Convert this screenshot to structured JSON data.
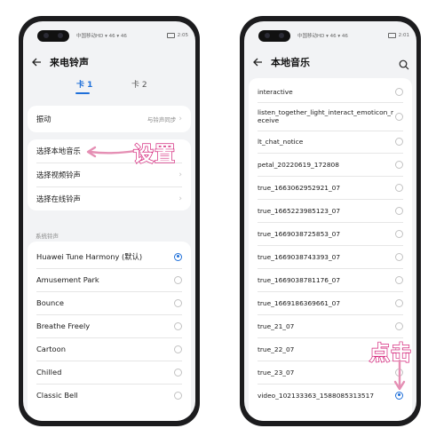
{
  "left": {
    "status": {
      "carrier": "中国移动HD ▾ 46 ▾ 46",
      "time": "2:05"
    },
    "title": "来电铃声",
    "tabs": [
      "卡 1",
      "卡 2"
    ],
    "settings": [
      {
        "label": "振动",
        "hint": "与铃声同步"
      },
      {
        "label": "选择本地音乐"
      },
      {
        "label": "选择视频铃声"
      },
      {
        "label": "选择在线铃声"
      }
    ],
    "section_label": "系统铃声",
    "ringtones": [
      {
        "label": "Huawei Tune Harmony (默认)",
        "selected": true
      },
      {
        "label": "Amusement Park",
        "selected": false
      },
      {
        "label": "Bounce",
        "selected": false
      },
      {
        "label": "Breathe Freely",
        "selected": false
      },
      {
        "label": "Cartoon",
        "selected": false
      },
      {
        "label": "Chilled",
        "selected": false
      },
      {
        "label": "Classic Bell",
        "selected": false
      }
    ],
    "annotation": "设置"
  },
  "right": {
    "status": {
      "carrier": "中国移动HD ▾ 46 ▾ 46",
      "time": "2:01"
    },
    "title": "本地音乐",
    "items": [
      {
        "label": "interactive",
        "selected": false
      },
      {
        "label": "listen_together_light_interact_emoticon_receive",
        "selected": false
      },
      {
        "label": "lt_chat_notice",
        "selected": false
      },
      {
        "label": "petal_20220619_172808",
        "selected": false
      },
      {
        "label": "true_1663062952921_07",
        "selected": false
      },
      {
        "label": "true_1665223985123_07",
        "selected": false
      },
      {
        "label": "true_1669038725853_07",
        "selected": false
      },
      {
        "label": "true_1669038743393_07",
        "selected": false
      },
      {
        "label": "true_1669038781176_07",
        "selected": false
      },
      {
        "label": "true_1669186369661_07",
        "selected": false
      },
      {
        "label": "true_21_07",
        "selected": false
      },
      {
        "label": "true_22_07",
        "selected": false
      },
      {
        "label": "true_23_07",
        "selected": false
      },
      {
        "label": "video_102133363_1588085313517",
        "selected": true
      }
    ],
    "annotation": "点击"
  },
  "colors": {
    "accent": "#1e6fd9",
    "annotation": "#d4237a"
  }
}
